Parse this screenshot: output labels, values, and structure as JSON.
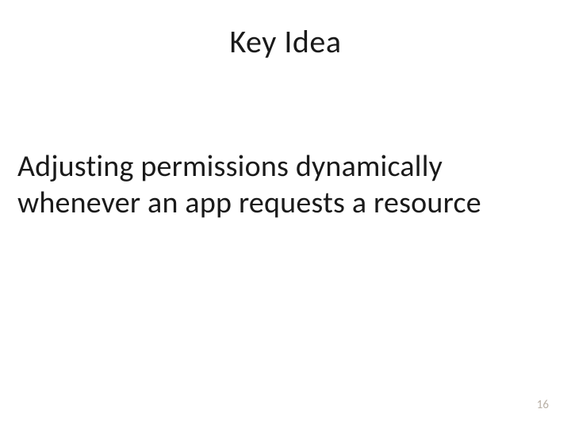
{
  "slide": {
    "title": "Key Idea",
    "body": "Adjusting permissions dynamically whenever an app requests a resource",
    "page_number": "16"
  }
}
